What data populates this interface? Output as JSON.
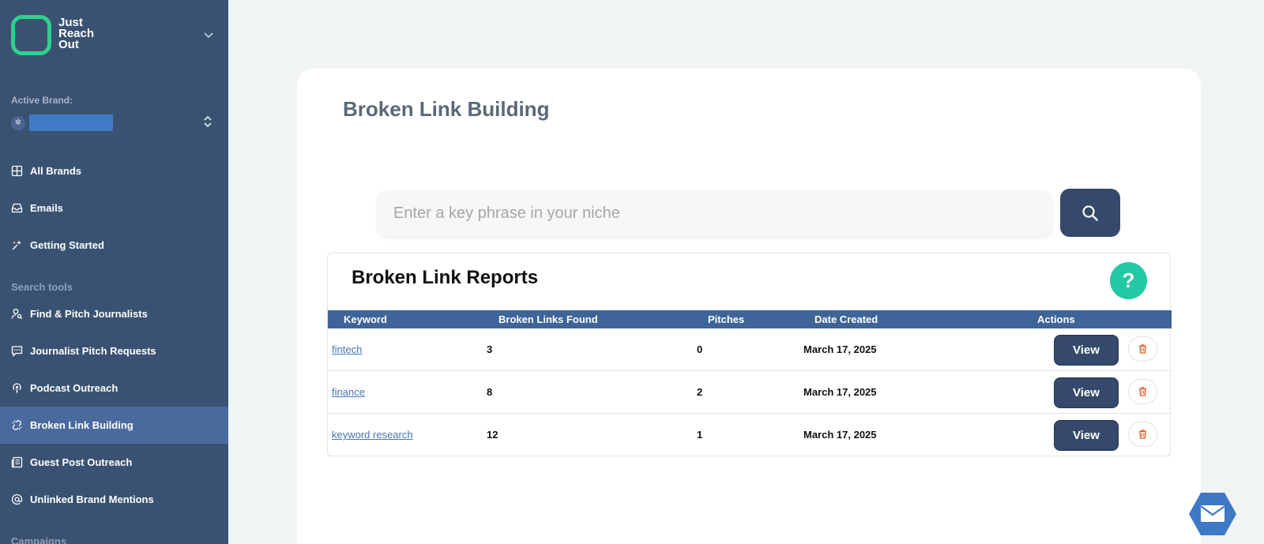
{
  "brand": {
    "logo_line1": "Just",
    "logo_line2": "Reach",
    "logo_line3": "Out",
    "accent": "#2fd08e"
  },
  "sidebar": {
    "active_brand_label": "Active Brand:",
    "items_top": [
      {
        "label": "All Brands",
        "icon": "grid-icon"
      },
      {
        "label": "Emails",
        "icon": "inbox-icon"
      },
      {
        "label": "Getting Started",
        "icon": "sparkle-icon"
      }
    ],
    "search_tools_label": "Search tools",
    "search_tools": [
      {
        "label": "Find & Pitch Journalists",
        "icon": "user-search-icon"
      },
      {
        "label": "Journalist Pitch Requests",
        "icon": "chat-icon"
      },
      {
        "label": "Podcast Outreach",
        "icon": "podcast-icon"
      },
      {
        "label": "Broken Link Building",
        "icon": "broken-link-icon",
        "active": true
      },
      {
        "label": "Guest Post Outreach",
        "icon": "newspaper-icon"
      },
      {
        "label": "Unlinked Brand Mentions",
        "icon": "at-icon"
      }
    ],
    "campaigns_label": "Campaigns"
  },
  "main": {
    "title": "Broken Link Building",
    "search": {
      "placeholder": "Enter a key phrase in your niche",
      "value": ""
    },
    "reports": {
      "title": "Broken Link Reports",
      "help_label": "?",
      "columns": [
        "Keyword",
        "Broken Links Found",
        "Pitches",
        "Date Created",
        "Actions"
      ],
      "rows": [
        {
          "keyword": "fintech",
          "broken_links": "3",
          "pitches": "0",
          "date": "March 17, 2025",
          "view_label": "View"
        },
        {
          "keyword": "finance",
          "broken_links": "8",
          "pitches": "2",
          "date": "March 17, 2025",
          "view_label": "View"
        },
        {
          "keyword": "keyword research",
          "broken_links": "12",
          "pitches": "1",
          "date": "March 17, 2025",
          "view_label": "View"
        }
      ]
    }
  },
  "colors": {
    "sidebar_bg": "#3a5272",
    "sidebar_active": "#4a6a9d",
    "primary_button": "#34496b",
    "table_header": "#3e6498",
    "help_button": "#22c9a3",
    "delete_icon": "#e05a1f"
  }
}
